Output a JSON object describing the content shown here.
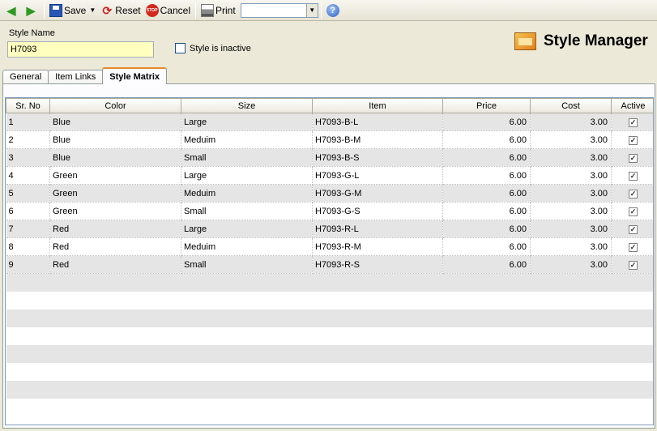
{
  "toolbar": {
    "save_label": "Save",
    "reset_label": "Reset",
    "cancel_label": "Cancel",
    "print_label": "Print",
    "print_selection": "",
    "icons": [
      "back-arrow-icon",
      "forward-arrow-icon",
      "save-icon",
      "reset-icon",
      "cancel-icon",
      "printer-icon",
      "help-icon"
    ]
  },
  "form": {
    "style_name_label": "Style Name",
    "style_name_value": "H7093",
    "inactive_label": "Style is inactive",
    "inactive_checked": false
  },
  "header": {
    "title": "Style Manager"
  },
  "tabs": [
    {
      "label": "General",
      "active": false
    },
    {
      "label": "Item Links",
      "active": false
    },
    {
      "label": "Style Matrix",
      "active": true
    }
  ],
  "grid": {
    "columns": [
      "Sr. No",
      "Color",
      "Size",
      "Item",
      "Price",
      "Cost",
      "Active"
    ],
    "rows": [
      [
        "1",
        "Blue",
        "Large",
        "H7093-B-L",
        "6.00",
        "3.00",
        true
      ],
      [
        "2",
        "Blue",
        "Meduim",
        "H7093-B-M",
        "6.00",
        "3.00",
        true
      ],
      [
        "3",
        "Blue",
        "Small",
        "H7093-B-S",
        "6.00",
        "3.00",
        true
      ],
      [
        "4",
        "Green",
        "Large",
        "H7093-G-L",
        "6.00",
        "3.00",
        true
      ],
      [
        "5",
        "Green",
        "Meduim",
        "H7093-G-M",
        "6.00",
        "3.00",
        true
      ],
      [
        "6",
        "Green",
        "Small",
        "H7093-G-S",
        "6.00",
        "3.00",
        true
      ],
      [
        "7",
        "Red",
        "Large",
        "H7093-R-L",
        "6.00",
        "3.00",
        true
      ],
      [
        "8",
        "Red",
        "Meduim",
        "H7093-R-M",
        "6.00",
        "3.00",
        true
      ],
      [
        "9",
        "Red",
        "Small",
        "H7093-R-S",
        "6.00",
        "3.00",
        true
      ]
    ]
  },
  "colors": {
    "window_bg": "#ece9d8",
    "input_highlight": "#ffffc0",
    "row_alt": "#e5e5e5",
    "active_tab_accent": "#e68b2c"
  }
}
